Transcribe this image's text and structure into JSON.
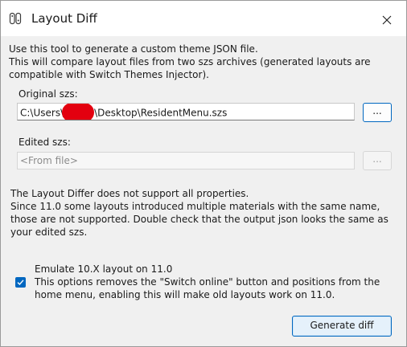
{
  "window": {
    "title": "Layout Diff",
    "app_icon": "switch-joycon-icon",
    "close_icon": "close-icon"
  },
  "intro": {
    "lines": [
      "Use this tool to generate a custom theme JSON file.",
      "This will compare layout files from two szs archives (generated layouts are",
      "compatible with Switch Themes Injector)."
    ]
  },
  "original": {
    "label": "Original szs:",
    "path_prefix": "C:\\Users\\",
    "path_suffix": "\\Desktop\\ResidentMenu.szs",
    "browse_label": "..."
  },
  "edited": {
    "label": "Edited szs:",
    "value": "<From file>",
    "browse_label": "...",
    "disabled": true
  },
  "note": {
    "lines": [
      "The Layout Differ does not support all properties.",
      "Since 11.0 some layouts introduced multiple materials with the same name,",
      "those are not supported. Double check that the output json looks the same as",
      "your edited szs."
    ]
  },
  "emulate": {
    "checked": true,
    "title": "Emulate 10.X layout on 11.0",
    "description_lines": [
      "This options removes the \"Switch online\" button and positions from the",
      "home menu, enabling this will make old layouts work on 11.0."
    ]
  },
  "actions": {
    "generate_label": "Generate diff"
  },
  "colors": {
    "accent": "#0067c0",
    "client_background": "#f0f0f0",
    "redaction": "#e3000f"
  }
}
